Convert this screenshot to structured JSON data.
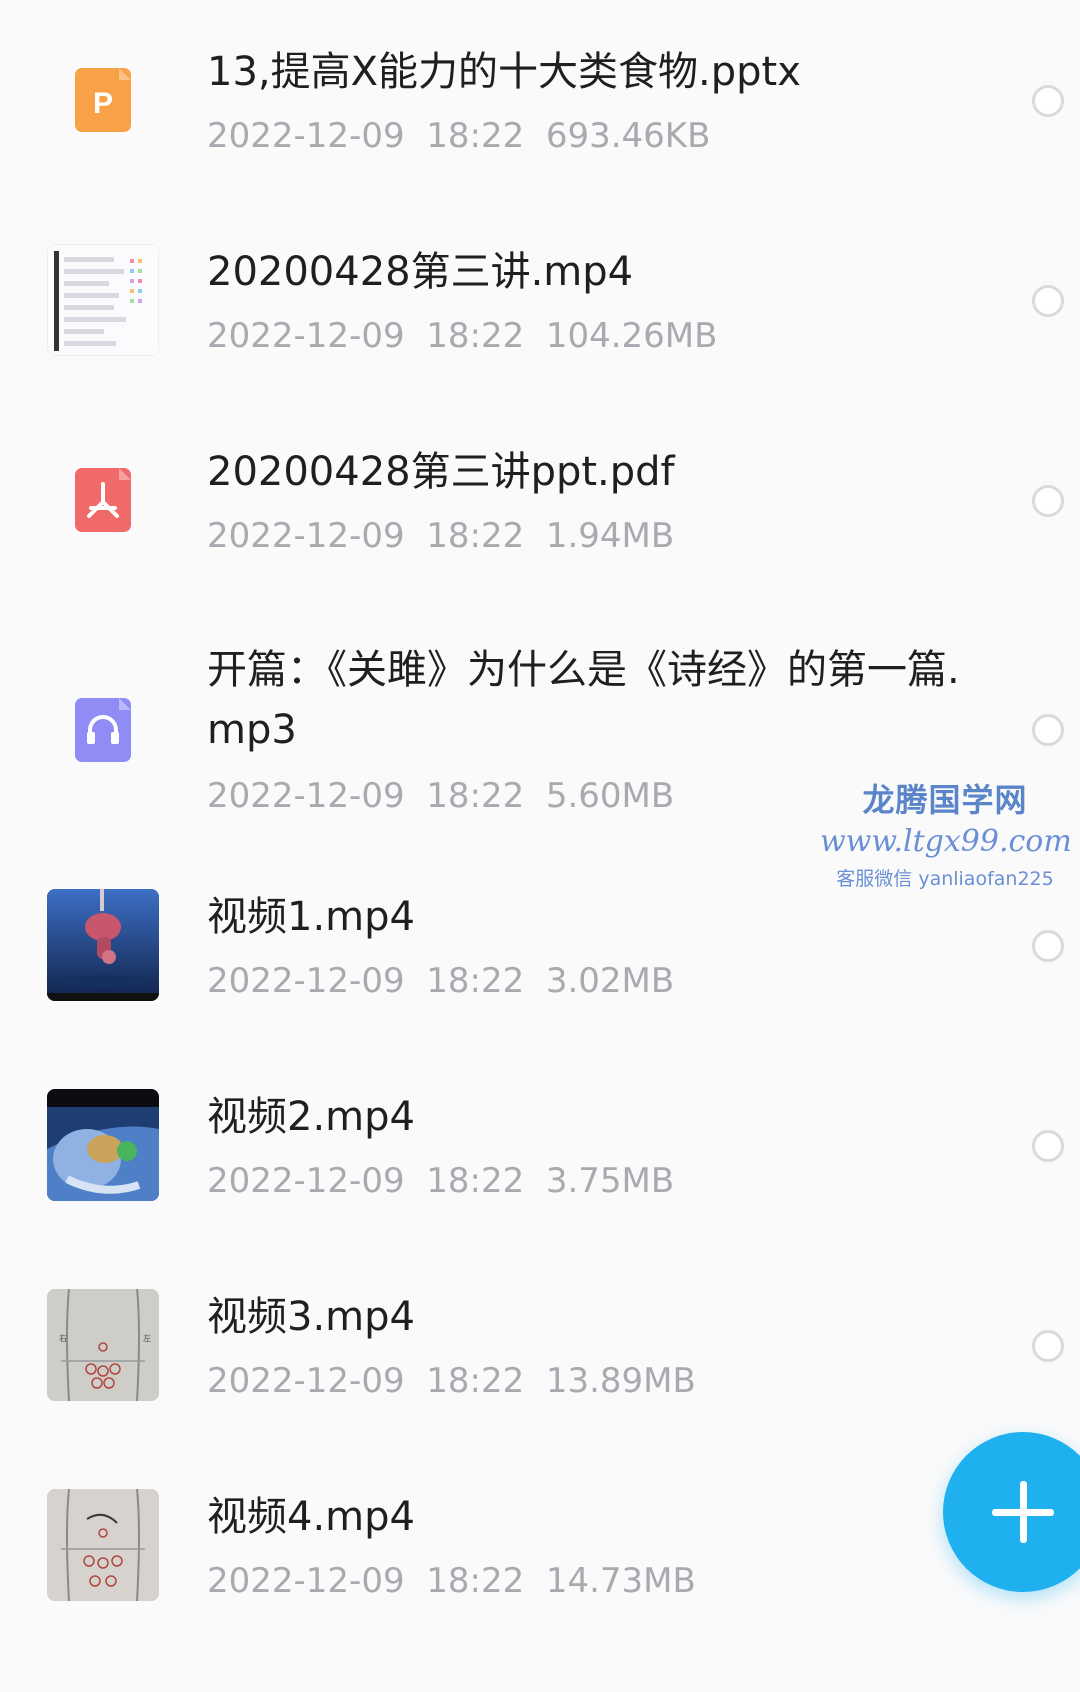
{
  "files": [
    {
      "name": "13,提高X能力的十大类食物.pptx",
      "date": "2022-12-09",
      "time": "18:22",
      "size": "693.46KB",
      "icon": "pptx-icon"
    },
    {
      "name": "20200428第三讲.mp4",
      "date": "2022-12-09",
      "time": "18:22",
      "size": "104.26MB",
      "icon": "video-thumbnail"
    },
    {
      "name": "20200428第三讲ppt.pdf",
      "date": "2022-12-09",
      "time": "18:22",
      "size": "1.94MB",
      "icon": "pdf-icon"
    },
    {
      "name": "开篇：《关雎》为什么是《诗经》的第一篇.mp3",
      "date": "2022-12-09",
      "time": "18:22",
      "size": "5.60MB",
      "icon": "audio-icon"
    },
    {
      "name": "视频1.mp4",
      "date": "2022-12-09",
      "time": "18:22",
      "size": "3.02MB",
      "icon": "video-thumbnail"
    },
    {
      "name": "视频2.mp4",
      "date": "2022-12-09",
      "time": "18:22",
      "size": "3.75MB",
      "icon": "video-thumbnail"
    },
    {
      "name": "视频3.mp4",
      "date": "2022-12-09",
      "time": "18:22",
      "size": "13.89MB",
      "icon": "video-thumbnail"
    },
    {
      "name": "视频4.mp4",
      "date": "2022-12-09",
      "time": "18:22",
      "size": "14.73MB",
      "icon": "video-thumbnail"
    }
  ],
  "watermark": {
    "title": "龙腾国学网",
    "url": "www.ltgx99.com",
    "contact": "客服微信 yanliaofan225"
  },
  "fab": {
    "icon": "plus-icon"
  },
  "colors": {
    "pptx": "#f8a147",
    "pdf": "#f06a6a",
    "audio": "#8f8cf5",
    "fab": "#1fb1ef",
    "meta_text": "#a8aab0"
  }
}
